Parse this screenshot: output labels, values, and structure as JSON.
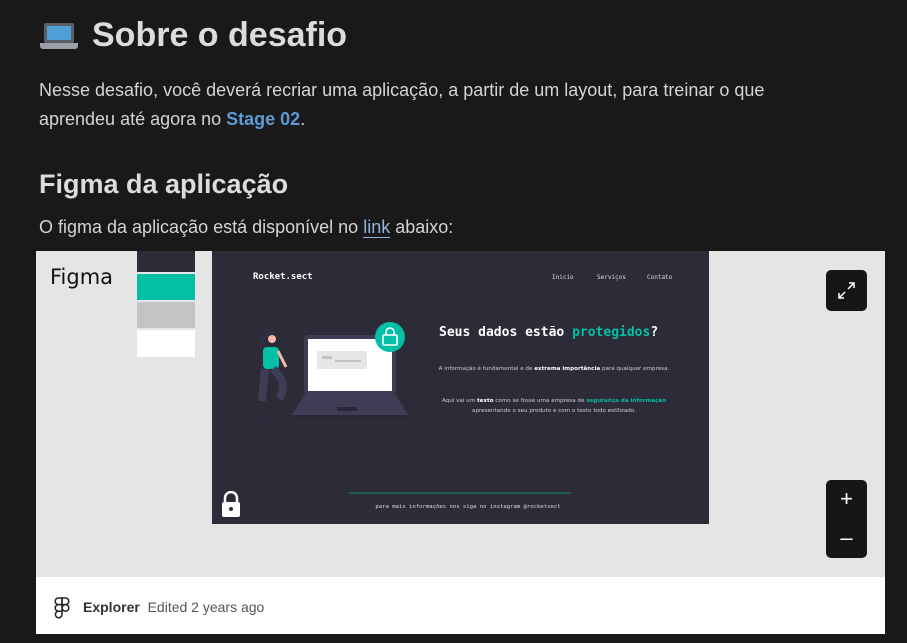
{
  "heading": {
    "title": "Sobre o desafio",
    "emoji": "laptop-icon"
  },
  "intro": {
    "text_before": "Nesse desafio, você deverá recriar uma aplicação, a partir de um layout, para treinar o que aprendeu até agora no ",
    "link": "Stage 02",
    "text_after": "."
  },
  "subheading": "Figma da aplicação",
  "figma_intro": {
    "before": "O figma da aplicação está disponível no ",
    "link": "link",
    "after": " abaixo:"
  },
  "embed": {
    "label": "Figma",
    "swatches": [
      "#2d2b38",
      "#03bfa5",
      "#c4c4c4",
      "#ffffff"
    ],
    "preview": {
      "logo": "Rocket.sect",
      "nav": [
        "Inicio",
        "Serviços",
        "Contato"
      ],
      "title_plain": "Seus dados estão ",
      "title_highlight": "protegidos",
      "title_end": "?",
      "p1_a": "A informação é fundamental e de ",
      "p1_b": "extrema importância",
      "p1_c": " para qualquer empresa.",
      "p2_a": "Aqui vai um ",
      "p2_b": "texto",
      "p2_c": " como se fosse uma empresa de ",
      "p2_d": "segurança da informação",
      "p2_e": " apresentando o seu produto e com o texto todo estilizado.",
      "footer": "para mais informações nos siga no instagram @rocketsect"
    },
    "zoom_in": "+",
    "zoom_out": "–",
    "footer": {
      "name": "Explorer",
      "edited": "Edited 2 years ago"
    }
  },
  "colors": {
    "accent": "#03bfa5",
    "link": "#5b9bd5",
    "background": "#191919"
  }
}
